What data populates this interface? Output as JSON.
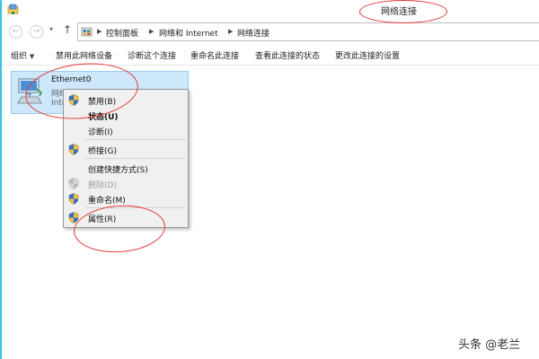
{
  "window": {
    "title": "网络连接",
    "app_icon": "network-folder-icon"
  },
  "nav": {
    "back_icon": "back-arrow-icon",
    "forward_icon": "forward-arrow-icon",
    "history_icon": "chevron-down-icon",
    "up_icon": "up-arrow-icon",
    "back_glyph": "←",
    "forward_glyph": "→",
    "history_glyph": "▾",
    "up_glyph": "↑"
  },
  "address": {
    "icon": "control-panel-icon",
    "separator": "▶",
    "crumbs": [
      "控制面板",
      "网络和 Internet",
      "网络连接"
    ]
  },
  "toolbar": {
    "organize": "组织",
    "organize_caret": "▼",
    "items": [
      "禁用此网络设备",
      "诊断这个连接",
      "重命名此连接",
      "查看此连接的状态",
      "更改此连接的设置"
    ]
  },
  "connection": {
    "icon": "network-adapter-icon",
    "name": "Ethernet0",
    "status": "网络",
    "device": "Inte"
  },
  "context_menu": {
    "items": [
      {
        "label": "禁用(B)",
        "icon": "uac-shield-icon"
      },
      {
        "label": "状态(U)",
        "bold": true
      },
      {
        "label": "诊断(I)"
      },
      {
        "label": "桥接(G)",
        "icon": "uac-shield-icon"
      },
      {
        "label": "创建快捷方式(S)"
      },
      {
        "label": "删除(D)",
        "icon": "uac-shield-icon",
        "disabled": true
      },
      {
        "label": "重命名(M)",
        "icon": "uac-shield-icon"
      },
      {
        "label": "属性(R)",
        "icon": "uac-shield-icon"
      }
    ]
  },
  "watermark": "头条 @老兰",
  "colors": {
    "selection_bg": "#cde8fb",
    "selection_border": "#98cbef",
    "annotation_red": "#e53935",
    "window_border": "#34c6e8"
  }
}
